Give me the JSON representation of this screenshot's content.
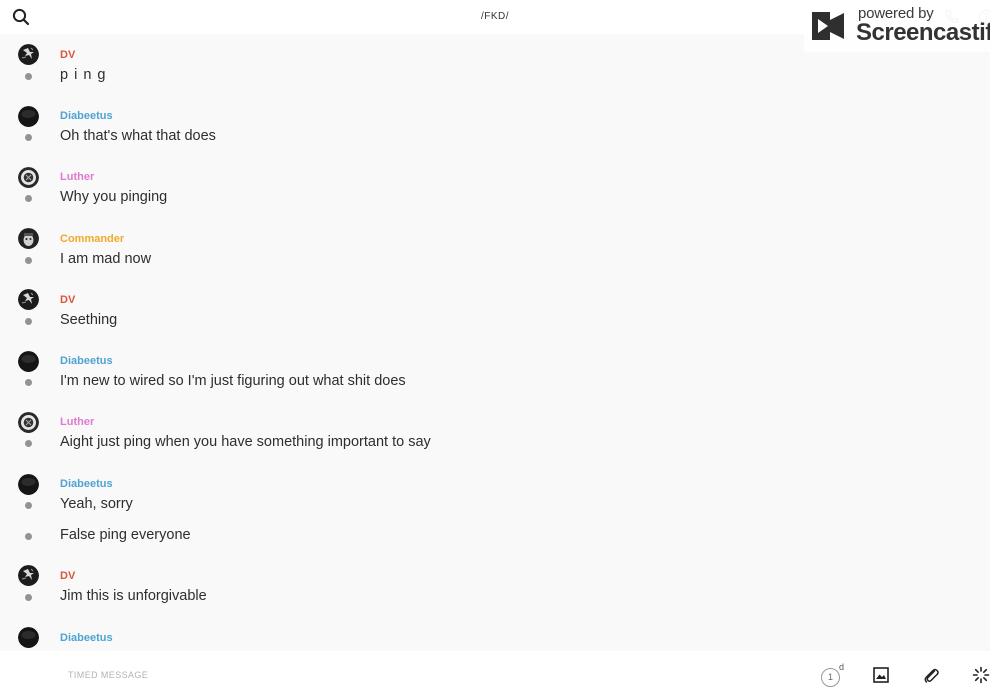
{
  "header": {
    "title": "/FKD/",
    "search_icon": "search-icon",
    "phone_icon": "phone-icon",
    "info_icon": "info-icon"
  },
  "watermark": {
    "powered": "powered by",
    "brand": "Screencastify"
  },
  "messages": [
    {
      "author": "DV",
      "text": "p i n g",
      "color": "#d9573a"
    },
    {
      "author": "Diabeetus",
      "text": "Oh that's what that does",
      "color": "#4fa3d1"
    },
    {
      "author": "Luther",
      "text": "Why you pinging",
      "color": "#e07ad1"
    },
    {
      "author": "Commander",
      "text": "I am mad now",
      "color": "#f0a92a"
    },
    {
      "author": "DV",
      "text": "Seething",
      "color": "#d9573a"
    },
    {
      "author": "Diabeetus",
      "text": "I'm new to wired so I'm just figuring out what shit does",
      "color": "#4fa3d1"
    },
    {
      "author": "Luther",
      "text": "Aight just ping when you have something important to say",
      "color": "#e07ad1"
    },
    {
      "author": "Diabeetus",
      "text": "Yeah, sorry",
      "color": "#4fa3d1"
    },
    {
      "author": "",
      "text": "False ping everyone",
      "color": ""
    },
    {
      "author": "DV",
      "text": "Jim this is unforgivable",
      "color": "#d9573a"
    },
    {
      "author": "Diabeetus",
      "text": "",
      "color": "#4fa3d1"
    }
  ],
  "composer": {
    "placeholder": "TIMED MESSAGE",
    "timer_value": "1",
    "timer_unit": "d",
    "image_icon": "image-icon",
    "attach_icon": "paperclip-icon",
    "effects_icon": "spinner-icon"
  }
}
